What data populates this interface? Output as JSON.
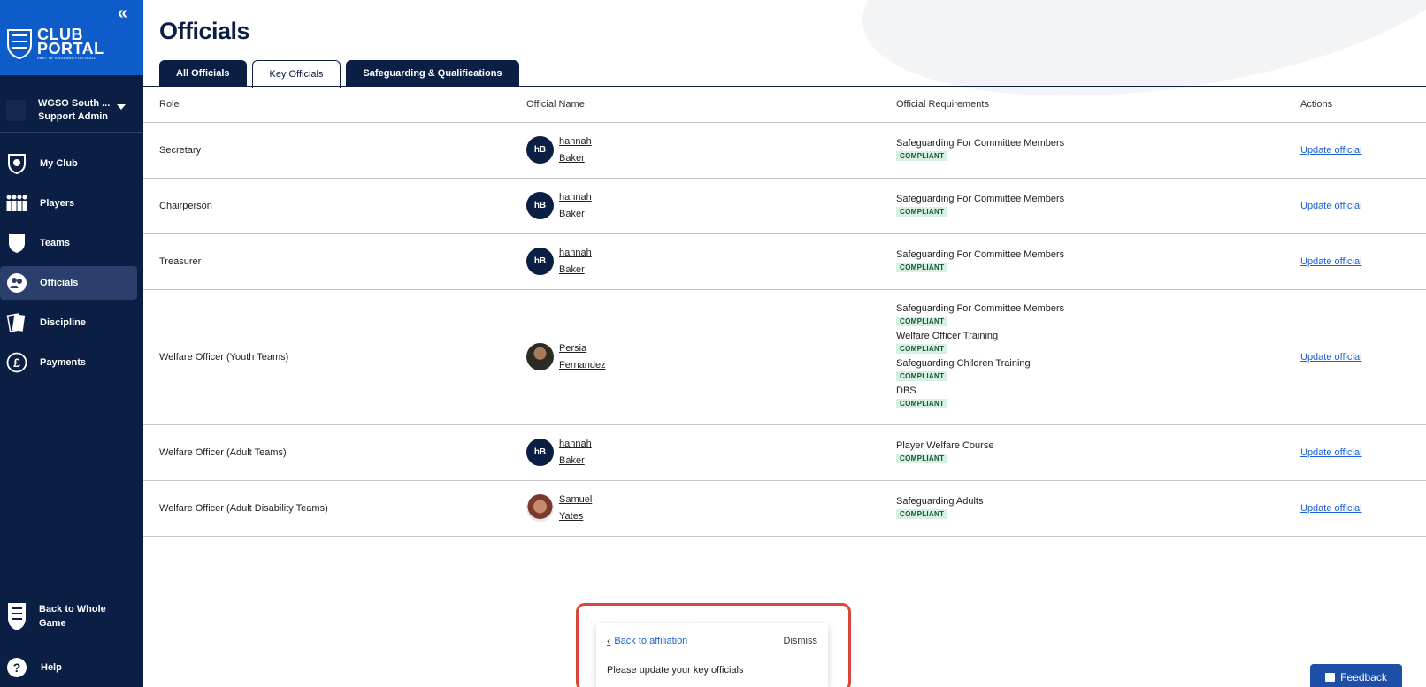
{
  "sidebar": {
    "collapse_label": "«",
    "logo": {
      "line1": "CLUB",
      "line2": "PORTAL",
      "tagline": "PART OF ENGLAND FOOTBALL"
    },
    "club": {
      "name": "WGSO South ...",
      "role": "Support Admin"
    },
    "items": [
      {
        "label": "My Club",
        "icon": "shield-icon"
      },
      {
        "label": "Players",
        "icon": "players-icon"
      },
      {
        "label": "Teams",
        "icon": "team-shield-icon"
      },
      {
        "label": "Officials",
        "icon": "officials-icon",
        "active": true
      },
      {
        "label": "Discipline",
        "icon": "cards-icon"
      },
      {
        "label": "Payments",
        "icon": "pound-icon"
      }
    ],
    "back_to_whole_game": {
      "line1": "Back to Whole",
      "line2": "Game"
    },
    "help": {
      "label": "Help",
      "icon_glyph": "?"
    }
  },
  "main": {
    "title": "Officials",
    "tabs": [
      {
        "label": "All Officials",
        "active": false
      },
      {
        "label": "Key Officials",
        "active": true
      },
      {
        "label": "Safeguarding & Qualifications",
        "active": false
      }
    ],
    "table": {
      "headers": [
        "Role",
        "Official Name",
        "Official Requirements",
        "Actions"
      ],
      "rows": [
        {
          "role": "Secretary",
          "initials": "hB",
          "first": "hannah",
          "last": "Baker",
          "requirements": [
            {
              "name": "Safeguarding For Committee Members",
              "status": "COMPLIANT"
            }
          ],
          "action": "Update official"
        },
        {
          "role": "Chairperson",
          "initials": "hB",
          "first": "hannah",
          "last": "Baker",
          "requirements": [
            {
              "name": "Safeguarding For Committee Members",
              "status": "COMPLIANT"
            }
          ],
          "action": "Update official"
        },
        {
          "role": "Treasurer",
          "initials": "hB",
          "first": "hannah",
          "last": "Baker",
          "requirements": [
            {
              "name": "Safeguarding For Committee Members",
              "status": "COMPLIANT"
            }
          ],
          "action": "Update official"
        },
        {
          "role": "Welfare Officer (Youth Teams)",
          "initials": "",
          "first": "Persia",
          "last": "Fernandez",
          "requirements": [
            {
              "name": "Safeguarding For Committee Members",
              "status": "COMPLIANT"
            },
            {
              "name": "Welfare Officer Training",
              "status": "COMPLIANT"
            },
            {
              "name": "Safeguarding Children Training",
              "status": "COMPLIANT"
            },
            {
              "name": "DBS",
              "status": "COMPLIANT"
            }
          ],
          "action": "Update official"
        },
        {
          "role": "Welfare Officer (Adult Teams)",
          "initials": "hB",
          "first": "hannah",
          "last": "Baker",
          "requirements": [
            {
              "name": "Player Welfare Course",
              "status": "COMPLIANT"
            }
          ],
          "action": "Update official"
        },
        {
          "role": "Welfare Officer (Adult Disability Teams)",
          "initials": "",
          "first": "Samuel",
          "last": "Yates",
          "requirements": [
            {
              "name": "Safeguarding Adults",
              "status": "COMPLIANT"
            }
          ],
          "action": "Update official"
        }
      ]
    }
  },
  "popup": {
    "back_label": "Back to affiliation",
    "dismiss_label": "Dismiss",
    "message": "Please update your key officials"
  },
  "feedback": {
    "label": "Feedback"
  },
  "colors": {
    "sidebar_bg": "#0b1e44",
    "logo_bg": "#0d5cc9",
    "link": "#1b5fd6",
    "compliant_bg": "#d8efe2",
    "highlight": "#d9473a"
  }
}
